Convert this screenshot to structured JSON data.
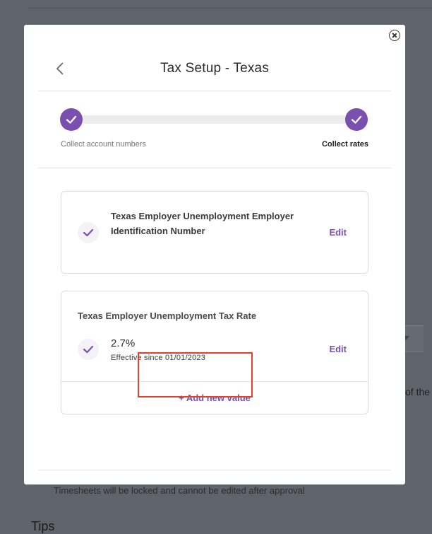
{
  "background": {
    "trailing_text": "of the",
    "timesheets_note": "Timesheets will be locked and cannot be edited after approval",
    "tips_heading": "Tips"
  },
  "modal": {
    "title": "Tax Setup - Texas",
    "stepper": {
      "steps": [
        {
          "label": "Collect account numbers",
          "completed": true,
          "active": false
        },
        {
          "label": "Collect rates",
          "completed": true,
          "active": true
        }
      ]
    },
    "cards": [
      {
        "title": "Texas Employer Unemployment Employer Identification Number",
        "edit_label": "Edit"
      },
      {
        "title": "Texas Employer Unemployment Tax Rate",
        "value": "2.7%",
        "effective": "Effective since 01/01/2023",
        "edit_label": "Edit",
        "add_label": "+ Add new value"
      }
    ]
  },
  "colors": {
    "accent": "#7a4fb0",
    "overlay": "#5f636b",
    "highlight": "#e5402a"
  },
  "icons": {
    "close": "close-circle-icon",
    "back": "chevron-left-icon",
    "check": "checkmark-icon"
  }
}
